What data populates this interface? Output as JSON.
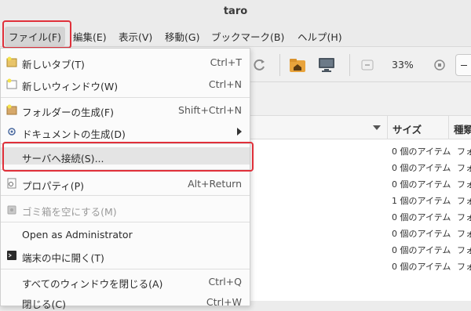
{
  "window": {
    "title": "taro"
  },
  "menubar": {
    "items": [
      "ファイル(F)",
      "編集(E)",
      "表示(V)",
      "移動(G)",
      "ブックマーク(B)",
      "ヘルプ(H)"
    ]
  },
  "toolbar": {
    "zoom": "33%"
  },
  "columns": {
    "size": "サイズ",
    "kind": "種類"
  },
  "rows": [
    {
      "size": "0 個のアイテム",
      "kind": "フォ"
    },
    {
      "size": "0 個のアイテム",
      "kind": "フォ"
    },
    {
      "size": "0 個のアイテム",
      "kind": "フォ"
    },
    {
      "size": "1 個のアイテム",
      "kind": "フォ"
    },
    {
      "size": "0 個のアイテム",
      "kind": "フォ"
    },
    {
      "size": "0 個のアイテム",
      "kind": "フォ"
    },
    {
      "size": "0 個のアイテム",
      "kind": "フォ"
    },
    {
      "size": "0 個のアイテム",
      "kind": "フォ"
    }
  ],
  "file_menu": {
    "new_tab": {
      "label": "新しいタブ(T)",
      "shortcut": "Ctrl+T"
    },
    "new_window": {
      "label": "新しいウィンドウ(W)",
      "shortcut": "Ctrl+N"
    },
    "create_folder": {
      "label": "フォルダーの生成(F)",
      "shortcut": "Shift+Ctrl+N"
    },
    "create_document": {
      "label": "ドキュメントの生成(D)"
    },
    "connect_server": {
      "label": "サーバへ接続(S)..."
    },
    "properties": {
      "label": "プロパティ(P)",
      "shortcut": "Alt+Return"
    },
    "empty_trash": {
      "label": "ゴミ箱を空にする(M)"
    },
    "open_admin": {
      "label": "Open as Administrator"
    },
    "open_terminal": {
      "label": "端末の中に開く(T)"
    },
    "close_all": {
      "label": "すべてのウィンドウを閉じる(A)",
      "shortcut": "Ctrl+Q"
    },
    "close": {
      "label": "閉じる(C)",
      "shortcut": "Ctrl+W"
    }
  },
  "colors": {
    "highlight_box": "#e0303a",
    "menu_bg": "#fbfbfb"
  }
}
